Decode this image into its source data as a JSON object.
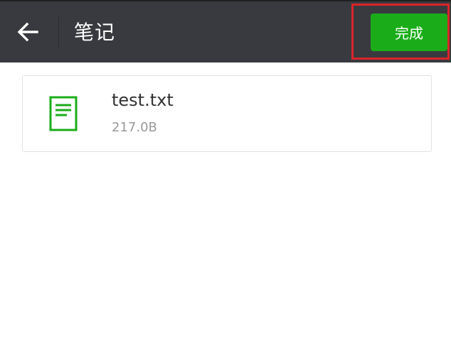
{
  "header": {
    "back_icon": "arrow-left-icon",
    "title": "笔记",
    "done_label": "完成"
  },
  "file": {
    "icon": "text-document-icon",
    "name": "test.txt",
    "size": "217.0B"
  },
  "colors": {
    "header_bg": "#393a3f",
    "accent_green": "#1aad19",
    "highlight_red": "#d9252a",
    "card_border": "#e2e2e2"
  }
}
